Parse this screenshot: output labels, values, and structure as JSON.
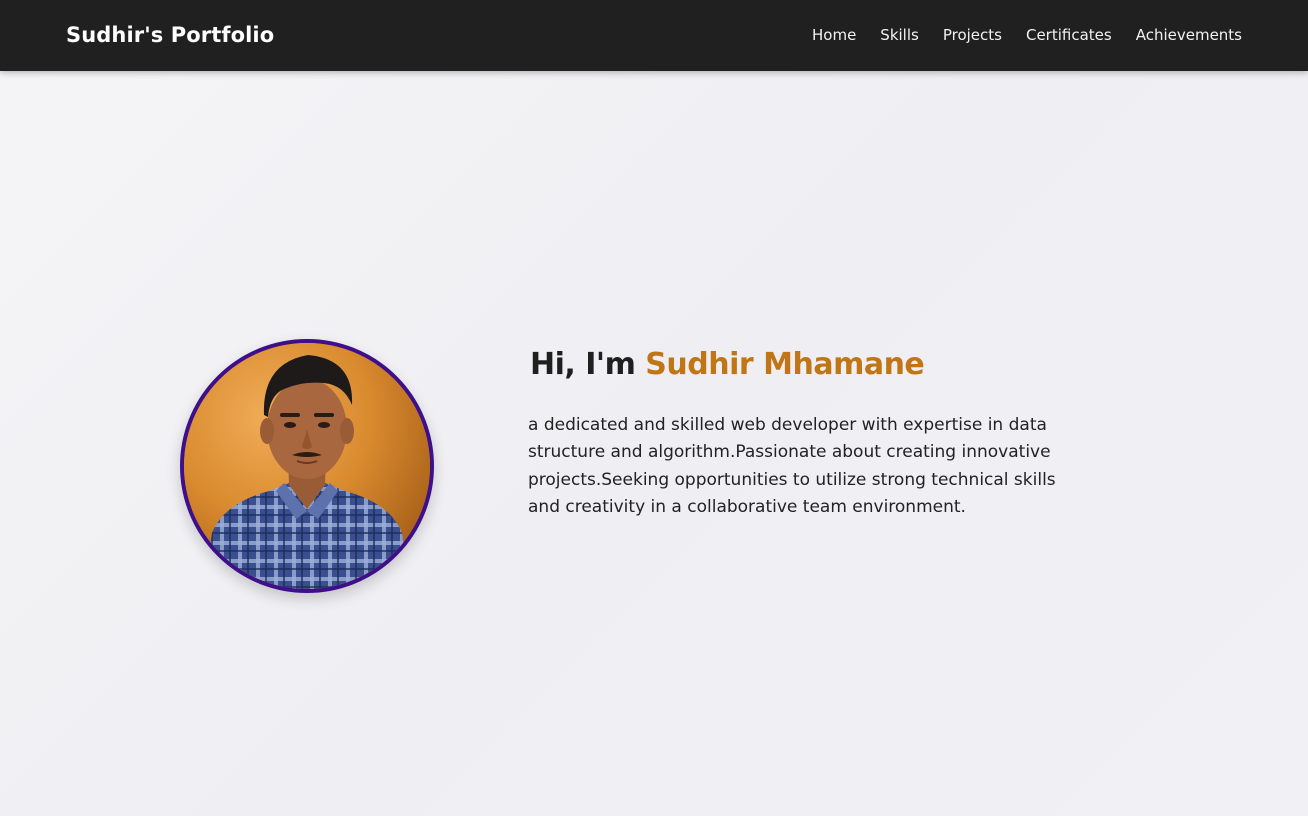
{
  "navbar": {
    "brand": "Sudhir's Portfolio",
    "links": [
      {
        "label": "Home"
      },
      {
        "label": "Skills"
      },
      {
        "label": "Projects"
      },
      {
        "label": "Certificates"
      },
      {
        "label": "Achievements"
      }
    ]
  },
  "hero": {
    "greeting": "Hi, I'm",
    "name": "Sudhir Mhamane",
    "description": "a dedicated and skilled web developer with expertise in data structure and algorithm.Passionate about creating innovative projects.Seeking opportunities to utilize strong technical skills and creativity in a collaborative team environment.",
    "avatar_icon": "profile-photo"
  },
  "colors": {
    "navbar_bg": "#202020",
    "accent": "#c07617",
    "avatar_border": "#3d0f8a"
  }
}
